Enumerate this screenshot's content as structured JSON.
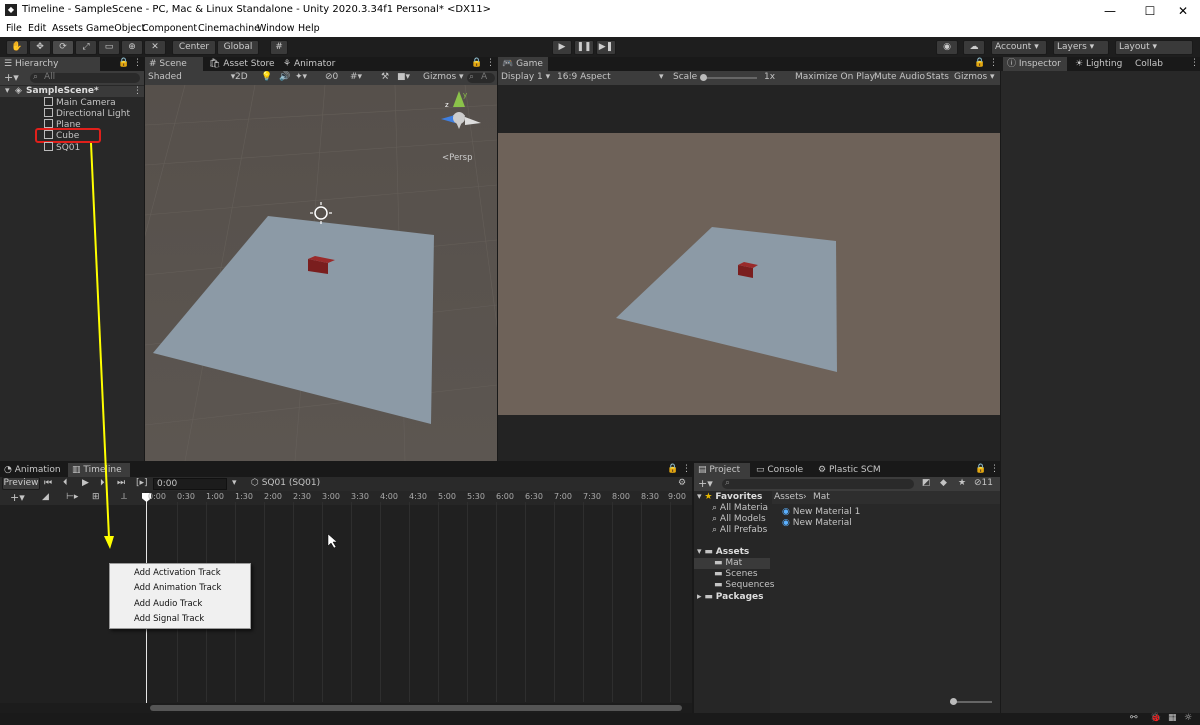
{
  "window": {
    "title": "Timeline - SampleScene - PC, Mac & Linux Standalone - Unity 2020.3.34f1 Personal* <DX11>",
    "minimize": "—",
    "maximize": "☐",
    "close": "✕"
  },
  "menu": [
    "File",
    "Edit",
    "Assets",
    "GameObject",
    "Component",
    "Cinemachine",
    "Window",
    "Help"
  ],
  "toolbar": {
    "center": "Center",
    "global": "Global",
    "account": "Account",
    "layers": "Layers",
    "layout": "Layout"
  },
  "hierarchy": {
    "tab": "Hierarchy",
    "search_placeholder": "All",
    "scene": "SampleScene*",
    "items": [
      "Main Camera",
      "Directional Light",
      "Plane",
      "Cube",
      "SQ01"
    ]
  },
  "scene_view": {
    "tabs": [
      "Scene",
      "Asset Store",
      "Animator"
    ],
    "shading": "Shaded",
    "mode_2d": "2D",
    "hidden_count": "0",
    "gizmos": "Gizmos",
    "search_placeholder": "A",
    "persp": "<Persp"
  },
  "game_view": {
    "tab": "Game",
    "display": "Display 1",
    "aspect": "16:9 Aspect",
    "scale_label": "Scale",
    "scale_value": "1x",
    "maximize": "Maximize On Play",
    "mute": "Mute Audio",
    "stats": "Stats",
    "gizmos": "Gizmos"
  },
  "inspector": {
    "tabs": [
      "Inspector",
      "Lighting",
      "Collab"
    ]
  },
  "timeline": {
    "tabs": [
      "Animation",
      "Timeline"
    ],
    "preview": "Preview",
    "time": "0:00",
    "asset": "SQ01 (SQ01)",
    "ticks": [
      "0:00",
      "0:30",
      "1:00",
      "1:30",
      "2:00",
      "2:30",
      "3:00",
      "3:30",
      "4:00",
      "4:30",
      "5:00",
      "5:30",
      "6:00",
      "6:30",
      "7:00",
      "7:30",
      "8:00",
      "8:30",
      "9:00"
    ]
  },
  "context_menu": [
    "Add Activation Track",
    "Add Animation Track",
    "Add Audio Track",
    "Add Signal Track"
  ],
  "project": {
    "tabs": [
      "Project",
      "Console",
      "Plastic SCM"
    ],
    "hidden_count": "11",
    "favorites": "Favorites",
    "fav_items": [
      "All Materia",
      "All Models",
      "All Prefabs"
    ],
    "assets": "Assets",
    "asset_items": [
      "Mat",
      "Scenes",
      "Sequences"
    ],
    "packages": "Packages",
    "breadcrumb": [
      "Assets",
      "Mat"
    ],
    "files": [
      "New Material 1",
      "New Material"
    ]
  },
  "colors": {
    "accent_red": "#e0201b",
    "arrow_yellow": "#ffff00",
    "plane": "#8c9aa6",
    "cube": "#7a1e1e",
    "game_bg": "#6e6259"
  }
}
